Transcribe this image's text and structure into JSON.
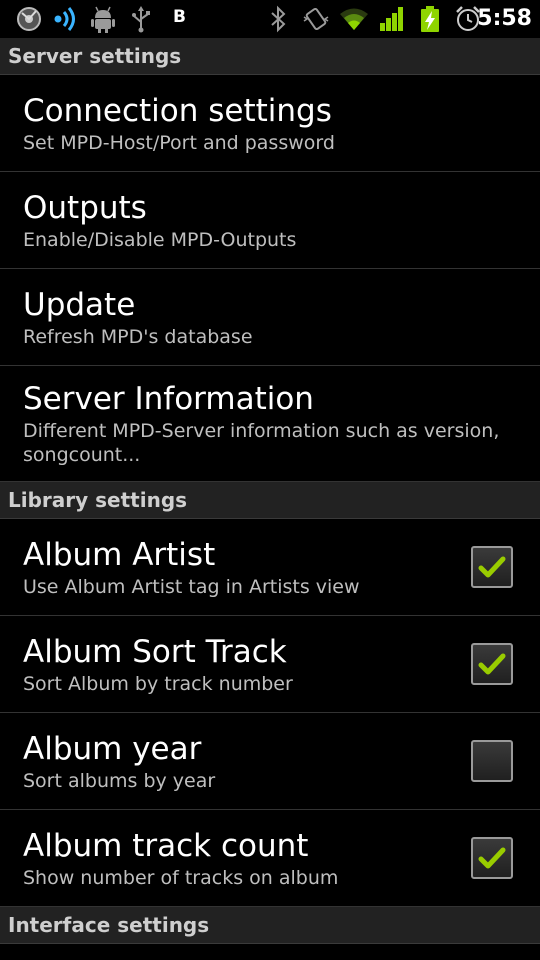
{
  "status_bar": {
    "time": "5:58",
    "notification_letter": "B",
    "accent_color": "#99cc00",
    "signal_color": "#8fd400",
    "battery_color": "#8fd400",
    "icons": [
      "mpdroid-icon",
      "wireless-icon",
      "android-debug-icon",
      "usb-icon",
      "b-letter-icon",
      "bluetooth-icon",
      "vibrate-icon",
      "wifi-icon",
      "signal-icon",
      "battery-charging-icon",
      "alarm-icon"
    ]
  },
  "sections": {
    "server": {
      "header": "Server settings",
      "items": [
        {
          "title": "Connection settings",
          "summary": "Set MPD-Host/Port and password"
        },
        {
          "title": "Outputs",
          "summary": "Enable/Disable MPD-Outputs"
        },
        {
          "title": "Update",
          "summary": "Refresh MPD's database"
        },
        {
          "title": "Server Information",
          "summary": "Different MPD-Server information such as version, songcount..."
        }
      ]
    },
    "library": {
      "header": "Library settings",
      "items": [
        {
          "title": "Album Artist",
          "summary": "Use Album Artist tag in Artists view",
          "checked": true
        },
        {
          "title": "Album Sort Track",
          "summary": "Sort Album by track number",
          "checked": true
        },
        {
          "title": "Album year",
          "summary": "Sort albums by year",
          "checked": false
        },
        {
          "title": "Album track count",
          "summary": "Show number of tracks on album",
          "checked": true
        }
      ]
    },
    "interface": {
      "header": "Interface settings"
    }
  },
  "checkmark_color": "#99cc00"
}
